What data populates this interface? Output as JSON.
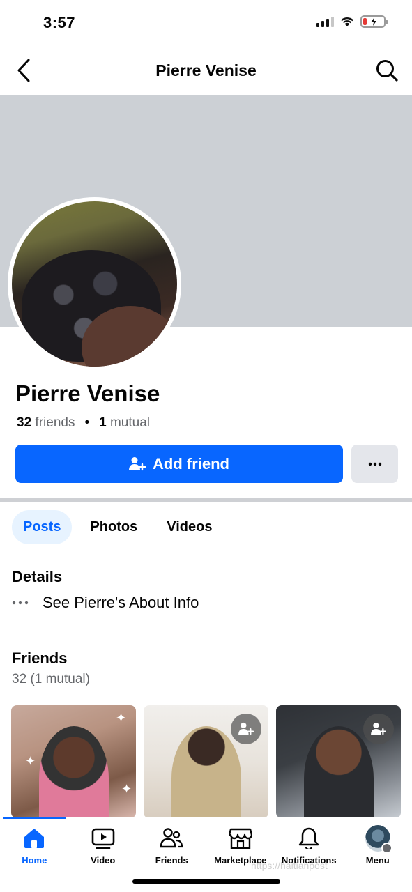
{
  "status_bar": {
    "time": "3:57"
  },
  "header": {
    "title": "Pierre Venise"
  },
  "profile": {
    "name": "Pierre Venise",
    "friends_count": "32",
    "friends_label": "friends",
    "mutual_count": "1",
    "mutual_label": "mutual"
  },
  "actions": {
    "add_friend_label": "Add friend"
  },
  "tabs": [
    {
      "label": "Posts",
      "active": true
    },
    {
      "label": "Photos",
      "active": false
    },
    {
      "label": "Videos",
      "active": false
    }
  ],
  "details": {
    "title": "Details",
    "about_link": "See Pierre's About Info"
  },
  "friends": {
    "title": "Friends",
    "count_text": "32 (1 mutual)"
  },
  "bottom_nav": {
    "items": [
      {
        "label": "Home",
        "icon": "home-icon",
        "active": true
      },
      {
        "label": "Video",
        "icon": "video-icon",
        "active": false
      },
      {
        "label": "Friends",
        "icon": "friends-icon",
        "active": false
      },
      {
        "label": "Marketplace",
        "icon": "marketplace-icon",
        "active": false
      },
      {
        "label": "Notifications",
        "icon": "bell-icon",
        "active": false
      },
      {
        "label": "Menu",
        "icon": "menu-avatar",
        "active": false
      }
    ]
  },
  "watermark": "https://haitianpost",
  "colors": {
    "accent": "#0866ff",
    "cover": "#ccd0d5",
    "secondary_text": "#65676b"
  }
}
